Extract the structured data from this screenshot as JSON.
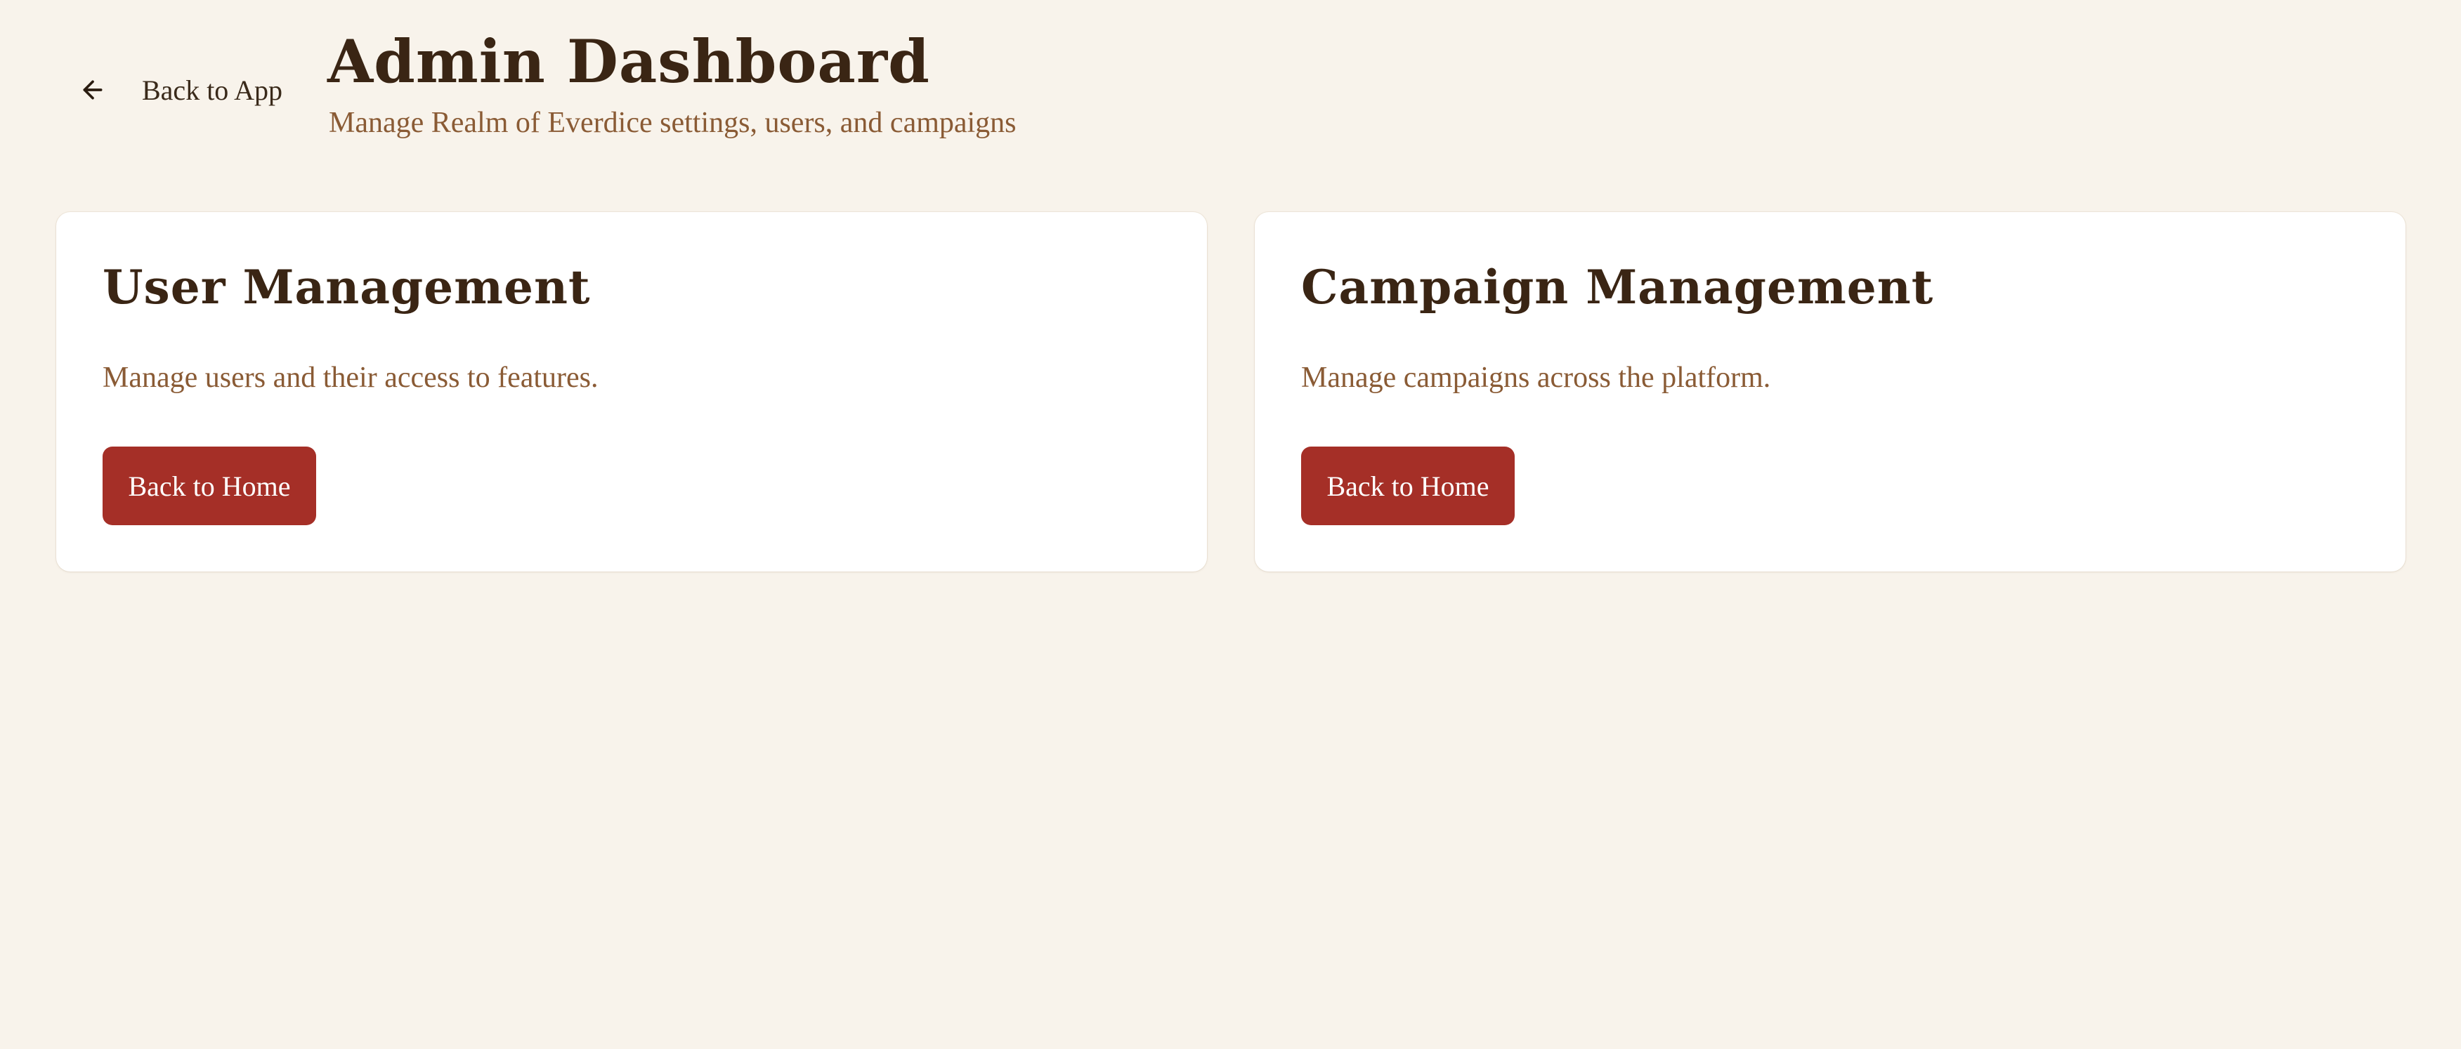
{
  "header": {
    "back_label": "Back to App",
    "back_icon": "arrow-left-icon",
    "title": "Admin Dashboard",
    "subtitle": "Manage Realm of Everdice settings, users, and campaigns"
  },
  "cards": [
    {
      "title": "User Management",
      "description": "Manage users and their access to features.",
      "button_label": "Back to Home"
    },
    {
      "title": "Campaign Management",
      "description": "Manage campaigns across the platform.",
      "button_label": "Back to Home"
    }
  ],
  "colors": {
    "background": "#f8f3eb",
    "card": "#ffffff",
    "title_text": "#3a2514",
    "muted_text": "#8a5b35",
    "button": "#a52f27",
    "button_text": "#ffffff"
  }
}
